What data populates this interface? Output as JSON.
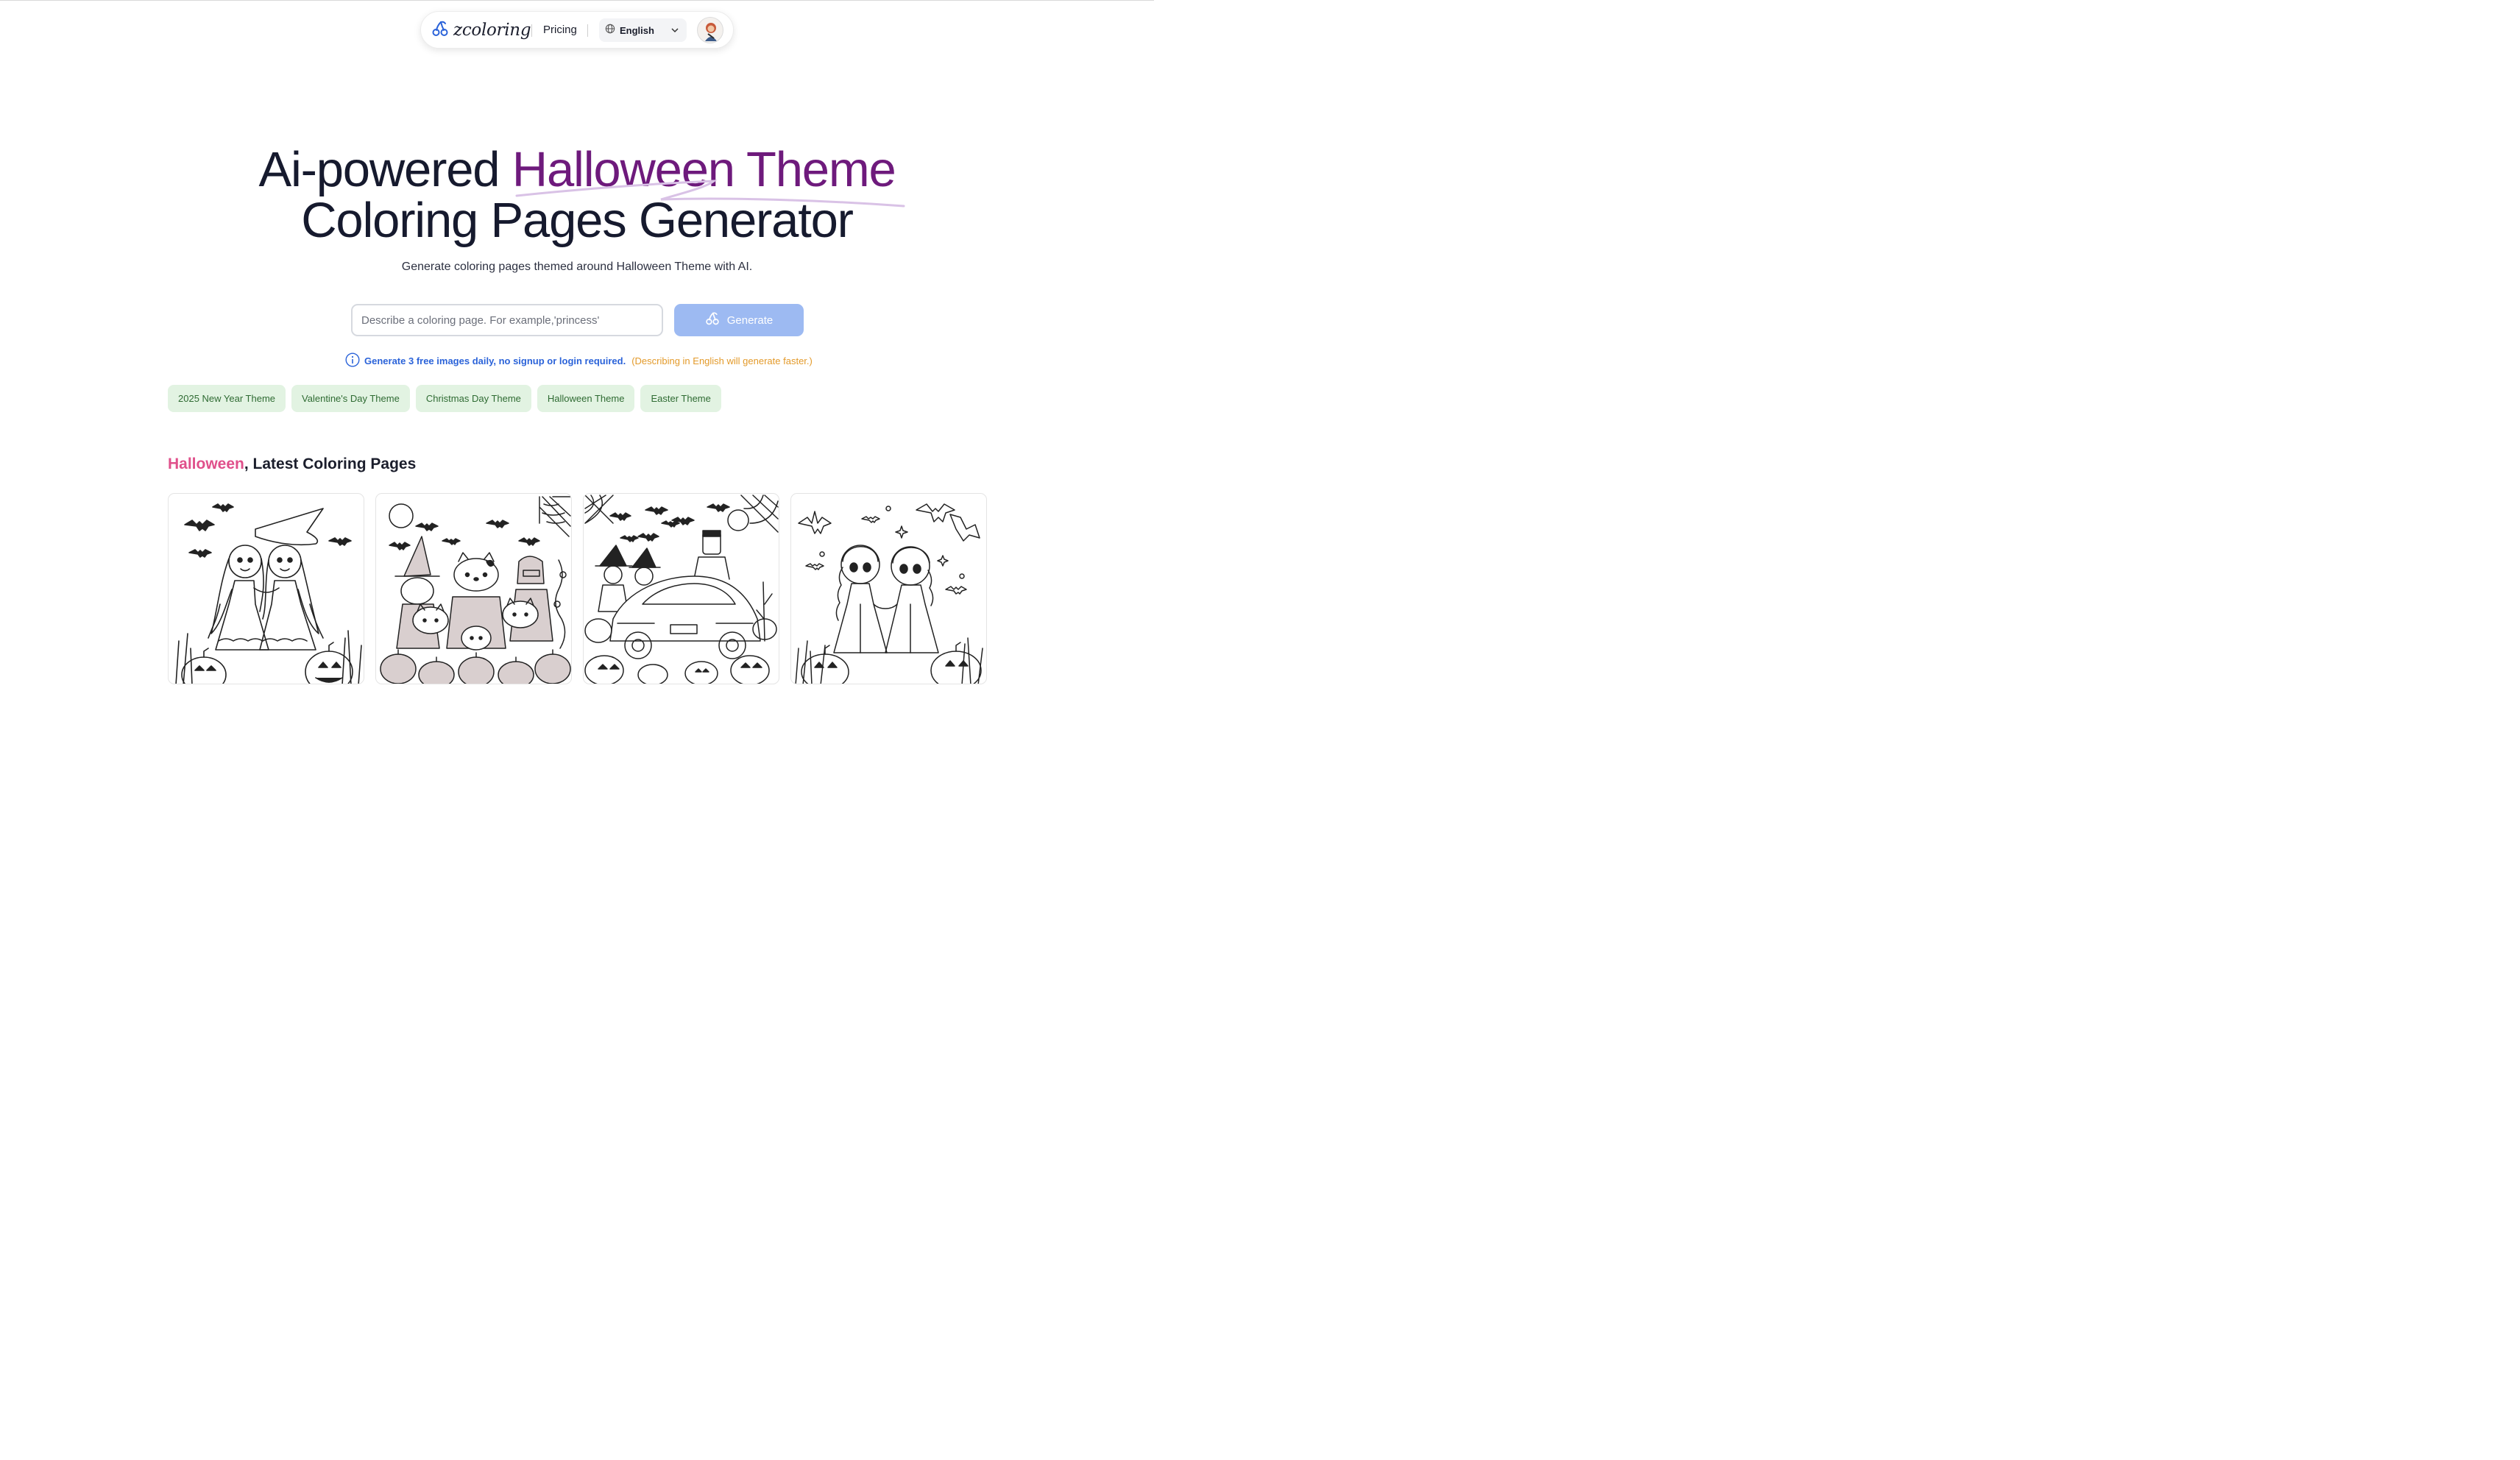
{
  "nav": {
    "brand": "zcoloring",
    "pricing": "Pricing",
    "language": "English"
  },
  "hero": {
    "title_part1": "Ai-powered ",
    "title_accent": "Halloween Theme",
    "title_part2": "Coloring Pages Generator",
    "subtitle": "Generate coloring pages themed around Halloween Theme with AI."
  },
  "search": {
    "placeholder": "Describe a coloring page. For example,'princess'",
    "value": "",
    "button_label": "Generate"
  },
  "notice": {
    "free_text": "Generate 3 free images daily, no signup or login required.",
    "hint_text": "(Describing in English will generate faster.)"
  },
  "tags": [
    "2025 New Year Theme",
    "Valentine's Day Theme",
    "Christmas Day Theme",
    "Halloween Theme",
    "Easter Theme"
  ],
  "section": {
    "title_accent": "Halloween",
    "title_rest": ", Latest Coloring Pages"
  },
  "cards": [
    {
      "subject": "two girls with witch hat, bats and pumpkins"
    },
    {
      "subject": "kitty characters in costumes with pumpkins and bats"
    },
    {
      "subject": "car with witches, bats and pumpkins"
    },
    {
      "subject": "two princesses holding hands with bats and pumpkins"
    }
  ],
  "icons": {
    "brand": "cherries-logo-icon",
    "language": "globe-icon",
    "dropdown": "chevron-down-icon",
    "generate": "cherries-icon",
    "info": "info-icon"
  },
  "colors": {
    "accent_purple": "#6e1a7c",
    "generate_button": "#9dbaf2",
    "notice_blue": "#2b63d9",
    "notice_orange": "#e39a2a",
    "tag_bg": "#e2f3e2",
    "tag_text": "#2f6b33",
    "section_pink": "#e0508b"
  }
}
